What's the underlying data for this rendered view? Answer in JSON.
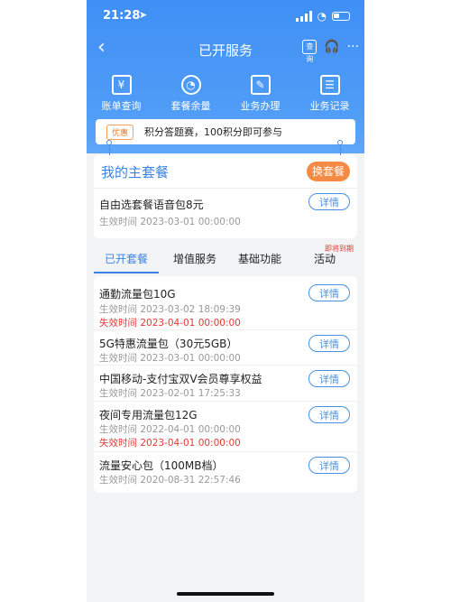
{
  "status_bar": {
    "time": "21:28",
    "location_arrow": "location-arrow-icon",
    "signal": "signal-icon",
    "wifi": "wifi-icon",
    "battery": "battery-icon"
  },
  "nav": {
    "back": "‹",
    "title": "已开服务",
    "service_badge": "查询",
    "headset_icon": "headset-icon",
    "more": "···"
  },
  "quick_actions": [
    {
      "label": "账单查询",
      "icon": "bill-icon",
      "glyph": "¥"
    },
    {
      "label": "套餐余量",
      "icon": "pie-chart-icon",
      "glyph": "◔"
    },
    {
      "label": "业务办理",
      "icon": "edit-icon",
      "glyph": "✎"
    },
    {
      "label": "业务记录",
      "icon": "list-icon",
      "glyph": "☰"
    }
  ],
  "promo": {
    "tag": "优惠",
    "text": "积分答题赛，100积分即可参与"
  },
  "main_plan": {
    "header": "我的主套餐",
    "change_button": "换套餐",
    "item": {
      "name": "自由选套餐语音包8元",
      "effective": "生效时间 2023-03-01 00:00:00",
      "detail_button": "详情"
    }
  },
  "tabs": [
    {
      "label": "已开套餐",
      "active": true
    },
    {
      "label": "增值服务",
      "active": false
    },
    {
      "label": "基础功能",
      "active": false
    },
    {
      "label": "活动",
      "active": false
    }
  ],
  "tab_badge": "即将到期",
  "services": [
    {
      "name": "通勤流量包10G",
      "effective": "生效时间 2023-03-02 18:09:39",
      "expire": "失效时间 2023-04-01 00:00:00",
      "detail": "详情"
    },
    {
      "name": "5G特惠流量包（30元5GB）",
      "effective": "生效时间 2023-03-01 00:00:00",
      "expire": "",
      "detail": "详情"
    },
    {
      "name": "中国移动-支付宝双V会员尊享权益",
      "effective": "生效时间 2023-02-01 17:25:33",
      "expire": "",
      "detail": "详情"
    },
    {
      "name": "夜间专用流量包12G",
      "effective": "生效时间 2022-04-01 00:00:00",
      "expire": "失效时间 2023-04-01 00:00:00",
      "detail": "详情"
    },
    {
      "name": "流量安心包（100MB档）",
      "effective": "生效时间 2020-08-31 22:57:46",
      "expire": "",
      "detail": "详情"
    }
  ],
  "colors": {
    "accent": "#3a83e8",
    "orange": "#f58a44",
    "red": "#e53935"
  }
}
